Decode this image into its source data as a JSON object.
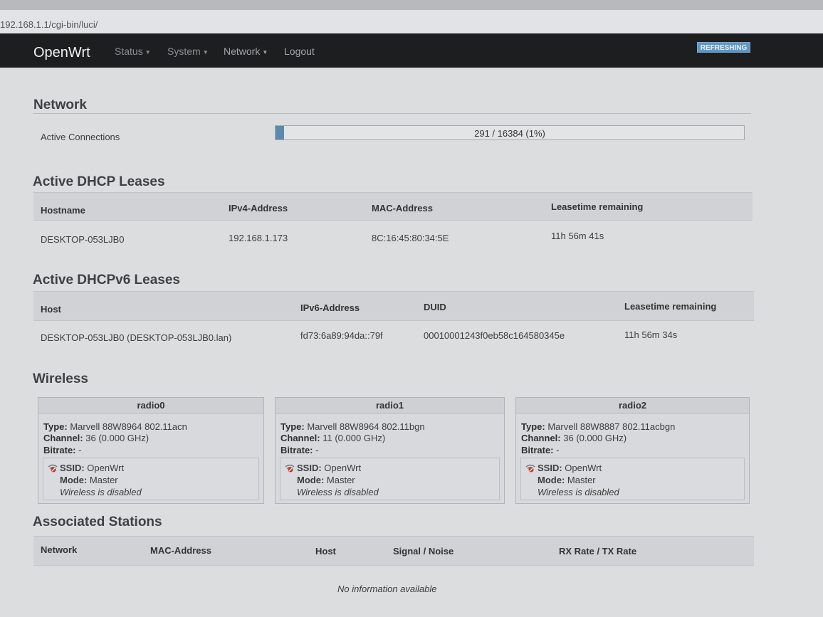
{
  "browser": {
    "url": "192.168.1.1/cgi-bin/luci/"
  },
  "navbar": {
    "brand": "OpenWrt",
    "menu": [
      "Status",
      "System",
      "Network",
      "Logout"
    ],
    "refresh_label": "REFRESHING"
  },
  "network": {
    "title": "Network",
    "active_connections_label": "Active Connections",
    "active_connections_text": "291 / 16384 (1%)",
    "active_connections_fraction": 0.0178
  },
  "dhcp": {
    "title": "Active DHCP Leases",
    "headers": [
      "Hostname",
      "IPv4-Address",
      "MAC-Address",
      "Leasetime remaining"
    ],
    "rows": [
      [
        "DESKTOP-053LJB0",
        "192.168.1.173",
        "8C:16:45:80:34:5E",
        "11h 56m 41s"
      ]
    ]
  },
  "dhcpv6": {
    "title": "Active DHCPv6 Leases",
    "headers": [
      "Host",
      "IPv6-Address",
      "DUID",
      "Leasetime remaining"
    ],
    "rows": [
      [
        "DESKTOP-053LJB0 (DESKTOP-053LJB0.lan)",
        "fd73:6a89:94da::79f",
        "00010001243f0eb58c164580345e",
        "11h 56m 34s"
      ]
    ]
  },
  "wireless": {
    "title": "Wireless",
    "labels": {
      "type": "Type:",
      "channel": "Channel:",
      "bitrate": "Bitrate:",
      "ssid": "SSID:",
      "mode": "Mode:"
    },
    "radios": [
      {
        "name": "radio0",
        "type": "Marvell 88W8964 802.11acn",
        "channel": "36 (0.000 GHz)",
        "bitrate": "-",
        "ssid": "OpenWrt",
        "mode": "Master",
        "status": "Wireless is disabled"
      },
      {
        "name": "radio1",
        "type": "Marvell 88W8964 802.11bgn",
        "channel": "11 (0.000 GHz)",
        "bitrate": "-",
        "ssid": "OpenWrt",
        "mode": "Master",
        "status": "Wireless is disabled"
      },
      {
        "name": "radio2",
        "type": "Marvell 88W8887 802.11acbgn",
        "channel": "36 (0.000 GHz)",
        "bitrate": "-",
        "ssid": "OpenWrt",
        "mode": "Master",
        "status": "Wireless is disabled"
      }
    ]
  },
  "stations": {
    "title": "Associated Stations",
    "headers": [
      "Network",
      "MAC-Address",
      "Host",
      "Signal / Noise",
      "RX Rate / TX Rate"
    ],
    "empty": "No information available"
  },
  "colors": {
    "navbar": "#1d1e20",
    "accent": "#5d89b0",
    "refresh": "#5f97c4",
    "disabled_icon": "#c0392b"
  }
}
